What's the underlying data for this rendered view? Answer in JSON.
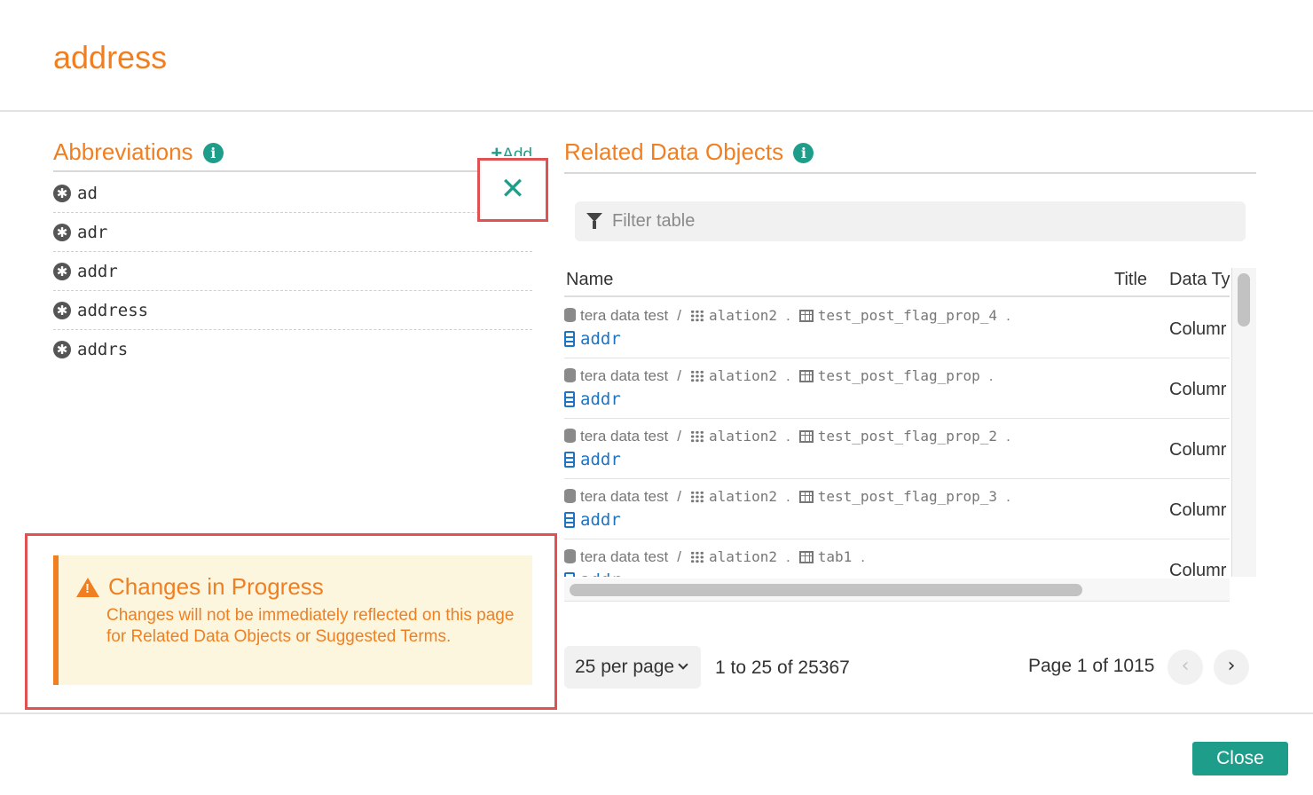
{
  "page": {
    "title": "address"
  },
  "abbreviations": {
    "title": "Abbreviations",
    "info_icon": "i",
    "add_label": "Add",
    "remove_icon": "✕",
    "items": [
      {
        "label": "ad"
      },
      {
        "label": "adr"
      },
      {
        "label": "addr"
      },
      {
        "label": "address"
      },
      {
        "label": "addrs"
      }
    ]
  },
  "alert": {
    "title": "Changes in Progress",
    "body": "Changes will not be immediately reflected on this page for Related Data Objects or Suggested Terms."
  },
  "related": {
    "title": "Related Data Objects",
    "info_icon": "i",
    "filter_placeholder": "Filter table",
    "columns": {
      "name": "Name",
      "title": "Title",
      "data_type": "Data Ty"
    },
    "rows": [
      {
        "datasource": "tera data test",
        "schema": "alation2",
        "table": "test_post_flag_prop_4",
        "column": "addr",
        "type": "Columr"
      },
      {
        "datasource": "tera data test",
        "schema": "alation2",
        "table": "test_post_flag_prop",
        "column": "addr",
        "type": "Columr"
      },
      {
        "datasource": "tera data test",
        "schema": "alation2",
        "table": "test_post_flag_prop_2",
        "column": "addr",
        "type": "Columr"
      },
      {
        "datasource": "tera data test",
        "schema": "alation2",
        "table": "test_post_flag_prop_3",
        "column": "addr",
        "type": "Columr"
      },
      {
        "datasource": "tera data test",
        "schema": "alation2",
        "table": "tab1",
        "column": "addr",
        "type": "Columr"
      }
    ],
    "pagination": {
      "per_page": "25 per page",
      "range": "1 to 25 of 25367",
      "page_info": "Page 1 of 1015",
      "prev_icon": "‹",
      "next_icon": "›"
    }
  },
  "footer": {
    "close_label": "Close"
  },
  "colors": {
    "accent_orange": "#f07f22",
    "teal": "#1e9e8a",
    "link_blue": "#1d73c4",
    "highlight_red": "#e05252"
  }
}
